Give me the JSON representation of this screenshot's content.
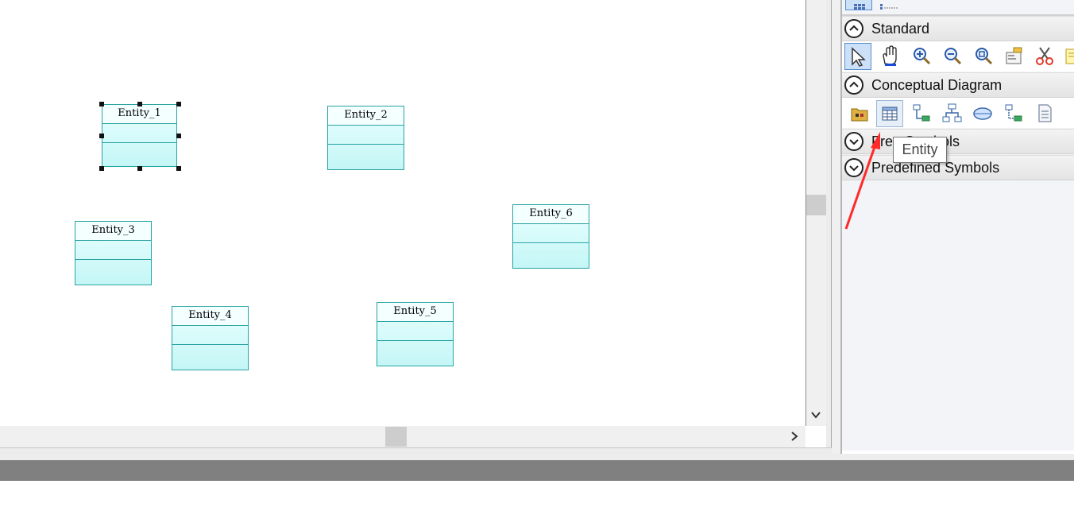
{
  "canvas": {
    "entities": [
      {
        "name": "Entity_1",
        "selected": true
      },
      {
        "name": "Entity_2",
        "selected": false
      },
      {
        "name": "Entity_3",
        "selected": false
      },
      {
        "name": "Entity_4",
        "selected": false
      },
      {
        "name": "Entity_5",
        "selected": false
      },
      {
        "name": "Entity_6",
        "selected": false
      }
    ]
  },
  "toolbox": {
    "groups": [
      {
        "label": "Standard",
        "expanded": true,
        "toggle_icon": "chevron-up-icon"
      },
      {
        "label": "Conceptual Diagram",
        "expanded": true,
        "toggle_icon": "chevron-up-icon"
      },
      {
        "label": "Free Symbols",
        "expanded": false,
        "toggle_icon": "chevron-down-icon"
      },
      {
        "label": "Predefined Symbols",
        "expanded": false,
        "toggle_icon": "chevron-down-icon"
      }
    ],
    "standard_tools": [
      "pointer-icon",
      "hand-icon",
      "zoom-in-icon",
      "zoom-out-icon",
      "zoom-fit-icon",
      "properties-icon",
      "cut-icon",
      "note-icon"
    ],
    "conceptual_tools": [
      "package-icon",
      "entity-icon",
      "relationship-icon",
      "inheritance-icon",
      "association-icon",
      "association-link-icon",
      "file-icon"
    ],
    "tooltip": "Entity"
  },
  "annotation": {
    "arrow_color": "#ff2a2a"
  },
  "colors": {
    "entity_border": "#2aa3a3",
    "entity_fill": "#c4f6f6",
    "selection_border": "#5a8ed0"
  }
}
